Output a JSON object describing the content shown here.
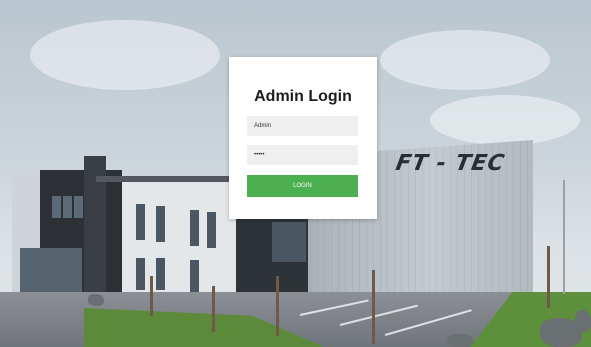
{
  "login": {
    "title": "Admin Login",
    "username": {
      "value": "Admin"
    },
    "password": {
      "value": "•••••"
    },
    "submit_label": "LOGIN"
  },
  "background": {
    "building_sign": "FT - TEC",
    "button_color": "#4caf50"
  }
}
